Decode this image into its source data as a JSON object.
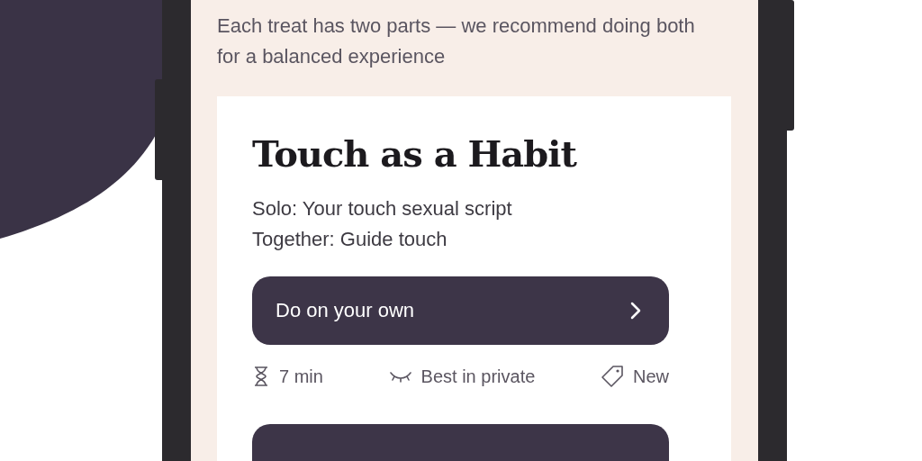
{
  "intro": "Each treat has two parts — we recommend doing both for a balanced experience",
  "card": {
    "title": "Touch as a Habit",
    "lines": [
      "Solo: Your touch sexual script",
      "Together: Guide touch"
    ],
    "action": {
      "label": "Do on your own"
    },
    "meta": [
      {
        "kind": "duration",
        "text": "7 min"
      },
      {
        "kind": "privacy",
        "text": "Best in private"
      },
      {
        "kind": "tag",
        "text": "New"
      }
    ]
  }
}
